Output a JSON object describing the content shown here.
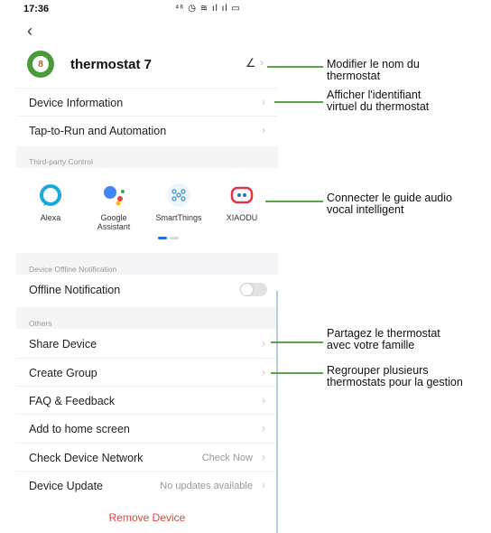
{
  "status_bar": {
    "time": "17:36",
    "icons": "⁴⁶ ◷ ≋ ıl ıl ▭"
  },
  "header": {
    "device_name": "thermostat 7",
    "avatar_glyph": "8"
  },
  "menu_top": [
    {
      "label": "Device Information"
    },
    {
      "label": "Tap-to-Run and Automation"
    }
  ],
  "third_party": {
    "title": "Third-party Control",
    "items": [
      {
        "name": "Alexa",
        "icon": "alexa-icon"
      },
      {
        "name": "Google Assistant",
        "icon": "google-assistant-icon"
      },
      {
        "name": "SmartThings",
        "icon": "smartthings-icon"
      },
      {
        "name": "XIAODU",
        "icon": "xiaodu-icon"
      }
    ]
  },
  "offline": {
    "title": "Device Offline Notification",
    "label": "Offline Notification",
    "enabled": false
  },
  "others": {
    "title": "Others",
    "items": [
      {
        "label": "Share Device",
        "value": ""
      },
      {
        "label": "Create Group",
        "value": ""
      },
      {
        "label": "FAQ & Feedback",
        "value": ""
      },
      {
        "label": "Add to home screen",
        "value": ""
      },
      {
        "label": "Check Device Network",
        "value": "Check Now"
      },
      {
        "label": "Device Update",
        "value": "No updates available"
      }
    ]
  },
  "remove_label": "Remove Device",
  "annotations": [
    {
      "text_1": "Modifier le nom du",
      "text_2": "thermostat"
    },
    {
      "text_1": "Afficher l'identifiant",
      "text_2": "virtuel du thermostat"
    },
    {
      "text_1": "Connecter le guide audio",
      "text_2": "vocal intelligent"
    },
    {
      "text_1": "Partagez le thermostat",
      "text_2": "avec votre famille"
    },
    {
      "text_1": "Regrouper plusieurs",
      "text_2": "thermostats pour la gestion"
    }
  ],
  "colors": {
    "accent_green": "#5aa54a",
    "remove_red": "#e0453a",
    "section_bg": "#f5f5f7"
  }
}
